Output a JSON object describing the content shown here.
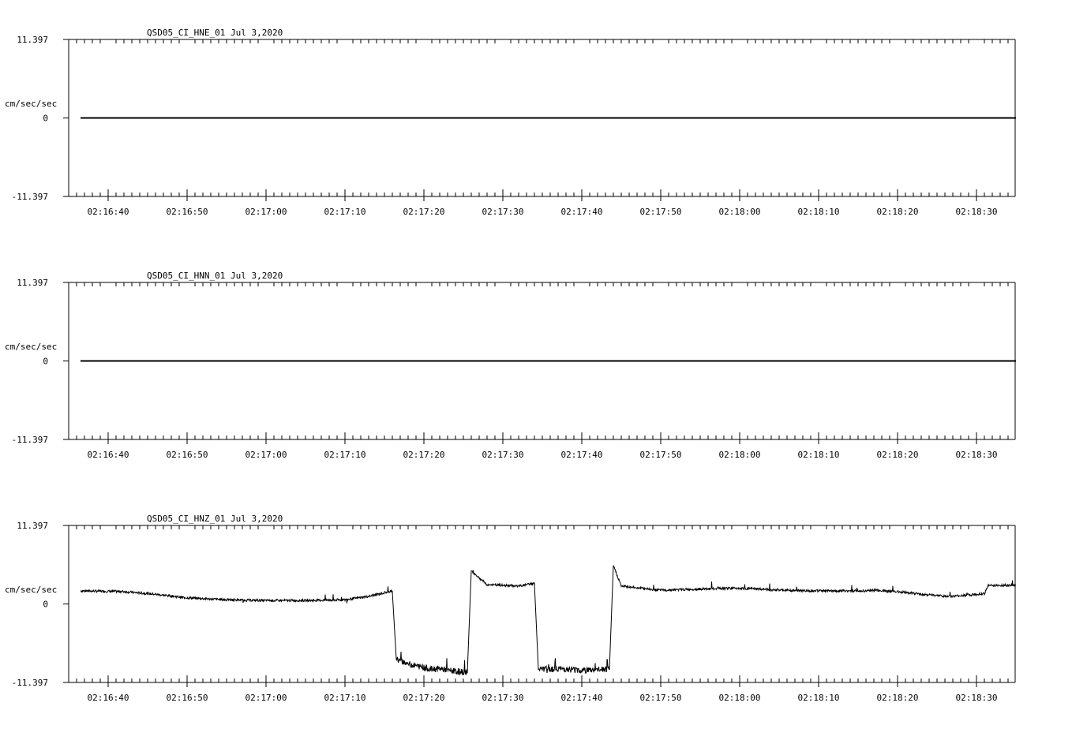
{
  "chart_data": [
    {
      "type": "line",
      "title": "QSD05_CI_HNE_01  Jul 3,2020",
      "ylabel": "cm/sec/sec",
      "yticks": [
        "11.397",
        "0",
        "-11.397"
      ],
      "ylim": [
        -11.397,
        11.397
      ],
      "xticks": [
        "02:16:40",
        "02:16:50",
        "02:17:00",
        "02:17:10",
        "02:17:20",
        "02:17:30",
        "02:17:40",
        "02:17:50",
        "02:18:00",
        "02:18:10",
        "02:18:20",
        "02:18:30"
      ],
      "series": [
        {
          "x": [
            "02:16:36.5",
            "02:18:35"
          ],
          "y": [
            0,
            0
          ]
        }
      ]
    },
    {
      "type": "line",
      "title": "QSD05_CI_HNN_01  Jul 3,2020",
      "ylabel": "cm/sec/sec",
      "yticks": [
        "11.397",
        "0",
        "-11.397"
      ],
      "ylim": [
        -11.397,
        11.397
      ],
      "xticks": [
        "02:16:40",
        "02:16:50",
        "02:17:00",
        "02:17:10",
        "02:17:20",
        "02:17:30",
        "02:17:40",
        "02:17:50",
        "02:18:00",
        "02:18:10",
        "02:18:20",
        "02:18:30"
      ],
      "series": [
        {
          "x": [
            "02:16:36.5",
            "02:18:35"
          ],
          "y": [
            0,
            0
          ]
        }
      ]
    },
    {
      "type": "line",
      "title": "QSD05_CI_HNZ_01  Jul 3,2020",
      "ylabel": "cm/sec/sec",
      "yticks": [
        "11.397",
        "0",
        "-11.397"
      ],
      "ylim": [
        -11.397,
        11.397
      ],
      "xticks": [
        "02:16:40",
        "02:16:50",
        "02:17:00",
        "02:17:10",
        "02:17:20",
        "02:17:30",
        "02:17:40",
        "02:17:50",
        "02:18:00",
        "02:18:10",
        "02:18:20",
        "02:18:30"
      ],
      "series": [
        {
          "x": [
            "02:16:36.5",
            "02:16:42",
            "02:16:46",
            "02:16:50",
            "02:16:55",
            "02:17:00",
            "02:17:05",
            "02:17:10",
            "02:17:13",
            "02:17:16",
            "02:17:16.5",
            "02:17:18",
            "02:17:21",
            "02:17:22",
            "02:17:24",
            "02:17:25.5",
            "02:17:26",
            "02:17:28",
            "02:17:32",
            "02:17:34",
            "02:17:34.5",
            "02:17:37",
            "02:17:40",
            "02:17:43.5",
            "02:17:44",
            "02:17:45",
            "02:17:50",
            "02:17:56",
            "02:17:56.5",
            "02:18:00",
            "02:18:05",
            "02:18:10",
            "02:18:16",
            "02:18:17",
            "02:18:20",
            "02:18:25",
            "02:18:27",
            "02:18:31",
            "02:18:31.5",
            "02:18:35"
          ],
          "y": [
            1.9,
            1.8,
            1.4,
            0.9,
            0.6,
            0.5,
            0.5,
            0.6,
            1.1,
            1.9,
            -8.0,
            -8.7,
            -9.5,
            -9.4,
            -9.8,
            -9.9,
            4.8,
            2.8,
            2.6,
            3.0,
            -9.5,
            -9.4,
            -9.6,
            -9.5,
            5.6,
            2.6,
            2.0,
            2.2,
            2.2,
            2.3,
            2.0,
            1.9,
            1.9,
            2.0,
            1.8,
            1.2,
            1.1,
            1.5,
            2.7,
            2.7
          ]
        }
      ]
    }
  ]
}
